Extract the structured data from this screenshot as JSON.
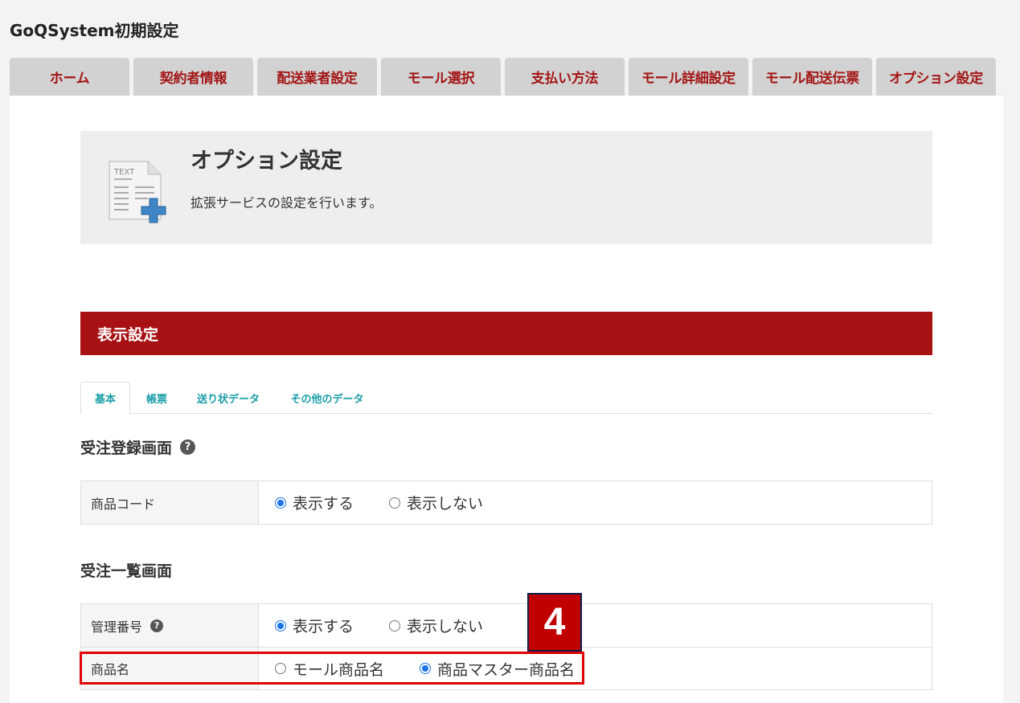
{
  "app": {
    "title": "GoQSystem初期設定"
  },
  "nav": {
    "tabs": [
      {
        "label": "ホーム"
      },
      {
        "label": "契約者情報"
      },
      {
        "label": "配送業者設定"
      },
      {
        "label": "モール選択"
      },
      {
        "label": "支払い方法"
      },
      {
        "label": "モール詳細設定"
      },
      {
        "label": "モール配送伝票"
      },
      {
        "label": "オプション設定"
      }
    ]
  },
  "header": {
    "icon_text": "TEXT",
    "title": "オプション設定",
    "description": "拡張サービスの設定を行います。"
  },
  "section": {
    "title": "表示設定"
  },
  "subtabs": [
    {
      "label": "基本",
      "active": true
    },
    {
      "label": "帳票"
    },
    {
      "label": "送り状データ"
    },
    {
      "label": "その他のデータ"
    }
  ],
  "order_entry": {
    "title": "受注登録画面",
    "rows": [
      {
        "label": "商品コード",
        "options": [
          "表示する",
          "表示しない"
        ],
        "selected": 0
      }
    ]
  },
  "order_list": {
    "title": "受注一覧画面",
    "rows": [
      {
        "label": "管理番号",
        "options": [
          "表示する",
          "表示しない"
        ],
        "selected": 0
      },
      {
        "label": "商品名",
        "options": [
          "モール商品名",
          "商品マスター商品名"
        ],
        "selected": 1
      }
    ]
  },
  "annotation": {
    "step": "4"
  },
  "colors": {
    "accent": "#a71113",
    "tab_text": "#a31515",
    "subtab_text": "#1a9da8",
    "radio": "#1a73e8"
  }
}
